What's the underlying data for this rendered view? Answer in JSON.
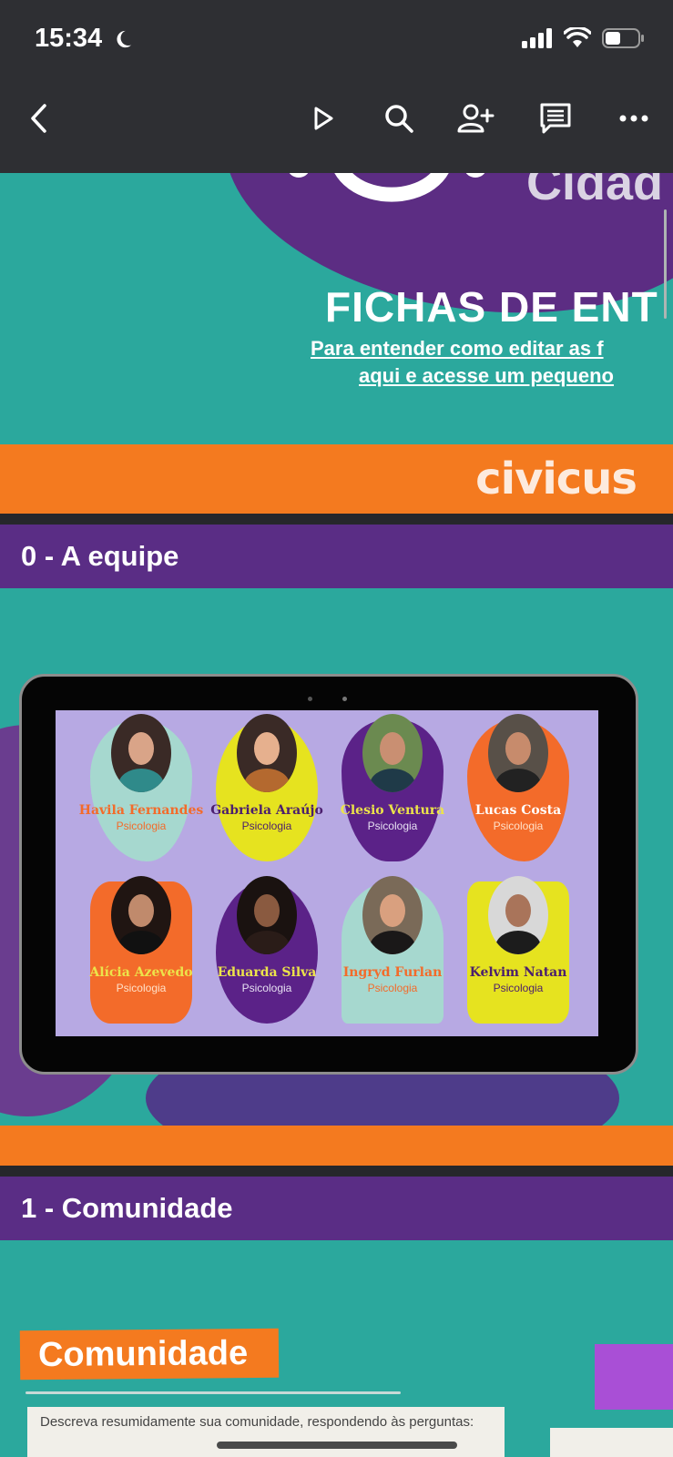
{
  "status_bar": {
    "time": "15:34",
    "icons": [
      "moon-icon",
      "signal-icon",
      "wifi-icon",
      "battery-icon"
    ]
  },
  "toolbar": {
    "icons": [
      "back-icon",
      "play-icon",
      "search-icon",
      "add-person-icon",
      "comment-icon",
      "more-icon"
    ]
  },
  "slide": {
    "logo_text": "Cidad",
    "title": "FICHAS DE ENT",
    "link_line1": "Para entender como editar as f",
    "link_line2": "aqui e acesse um pequeno",
    "brand": "civicus"
  },
  "sections": [
    {
      "title": "0 - A equipe"
    },
    {
      "title": "1 - Comunidade"
    }
  ],
  "team": [
    {
      "name": "Havila Fernandes",
      "role": "Psicologia"
    },
    {
      "name": "Gabriela Araújo",
      "role": "Psicologia"
    },
    {
      "name": "Clesio Ventura",
      "role": "Psicologia"
    },
    {
      "name": "Lucas Costa",
      "role": "Psicologia"
    },
    {
      "name": "Alícia Azevedo",
      "role": "Psicologia"
    },
    {
      "name": "Eduarda Silva",
      "role": "Psicologia"
    },
    {
      "name": "Ingryd Furlan",
      "role": "Psicologia"
    },
    {
      "name": "Kelvim Natan",
      "role": "Psicologia"
    }
  ],
  "comunidade": {
    "tag": "Comunidade",
    "prompt": "Descreva resumidamente sua comunidade, respondendo às perguntas:"
  },
  "colors": {
    "teal": "#2ba89d",
    "purple": "#5a2d85",
    "orange": "#f47a1f",
    "lavender": "#b7a9e3"
  }
}
